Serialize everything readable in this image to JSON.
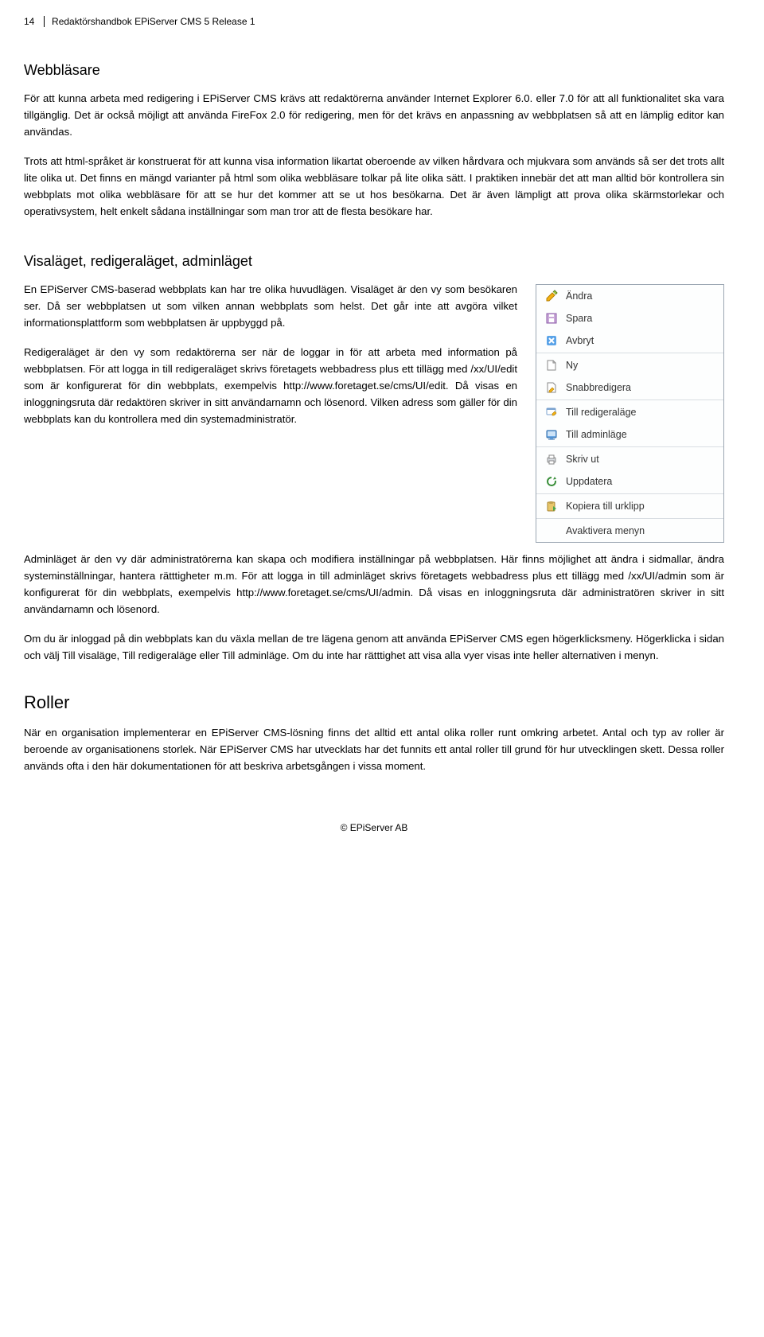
{
  "header": {
    "page_number": "14",
    "doc_title": "Redaktörshandbok EPiServer CMS 5 Release 1"
  },
  "sections": {
    "webblasare": {
      "title": "Webbläsare",
      "p1": "För att kunna arbeta med redigering i EPiServer CMS krävs att redaktörerna använder Internet Explorer 6.0. eller 7.0 för att all funktionalitet ska vara tillgänglig. Det är också möjligt att använda FireFox 2.0 för redigering, men för det krävs en anpassning av webbplatsen så att en lämplig editor kan användas.",
      "p2": "Trots att html-språket är konstruerat för att kunna visa information likartat oberoende av vilken hårdvara och mjukvara som används så ser det trots allt lite olika ut. Det finns en mängd varianter på html som olika webbläsare tolkar på lite olika sätt. I praktiken innebär det att man alltid bör kontrollera sin webbplats mot olika webbläsare för att se hur det kommer att se ut hos besökarna. Det är även lämpligt att prova olika skärmstorlekar och operativsystem, helt enkelt sådana inställningar som man tror att de flesta besökare har."
    },
    "visalaget": {
      "title": "Visaläget, redigeraläget, adminläget",
      "p1": "En EPiServer CMS-baserad webbplats kan har tre olika huvudlägen. Visaläget är den vy som besökaren ser. Då ser webbplatsen ut som vilken annan webbplats som helst. Det går inte att avgöra vilket informationsplattform som webbplatsen är uppbyggd på.",
      "p2": "Redigeraläget är den vy som redaktörerna ser när de loggar in för att arbeta med information på webbplatsen. För att logga in till redigeraläget skrivs företagets webbadress plus ett tillägg med /xx/UI/edit som är konfigurerat för din webbplats, exempelvis http://www.foretaget.se/cms/UI/edit. Då visas en inloggningsruta där redaktören skriver in sitt användarnamn och lösenord. Vilken adress som gäller för din webbplats kan du kontrollera med din systemadministratör.",
      "p3": "Adminläget är den vy där administratörerna kan skapa och modifiera inställningar på webbplatsen. Här finns möjlighet att ändra i sidmallar, ändra systeminställningar, hantera rätttigheter m.m. För att logga in till adminläget skrivs företagets webbadress plus ett tillägg med /xx/UI/admin som är konfigurerat för din webbplats, exempelvis http://www.foretaget.se/cms/UI/admin. Då visas en inloggningsruta där administratören skriver in sitt användarnamn och lösenord.",
      "p4": "Om du är inloggad på din webbplats kan du växla mellan de tre lägena genom att använda EPiServer CMS egen högerklicksmeny. Högerklicka i sidan och välj Till visaläge, Till redigeraläge eller Till adminläge. Om du inte har rätttighet att visa alla vyer visas inte heller alternativen i menyn."
    },
    "context_menu": {
      "items": [
        {
          "label": "Ändra",
          "icon": "pencil-icon"
        },
        {
          "label": "Spara",
          "icon": "save-icon"
        },
        {
          "label": "Avbryt",
          "icon": "cancel-icon"
        },
        {
          "label": "Ny",
          "icon": "new-page-icon"
        },
        {
          "label": "Snabbredigera",
          "icon": "quick-edit-icon"
        },
        {
          "label": "Till redigeraläge",
          "icon": "to-edit-mode-icon"
        },
        {
          "label": "Till adminläge",
          "icon": "to-admin-mode-icon"
        },
        {
          "label": "Skriv ut",
          "icon": "print-icon"
        },
        {
          "label": "Uppdatera",
          "icon": "refresh-icon"
        },
        {
          "label": "Kopiera till urklipp",
          "icon": "copy-clipboard-icon"
        },
        {
          "label": "Avaktivera menyn",
          "icon": ""
        }
      ]
    },
    "roller": {
      "title": "Roller",
      "p1": "När en organisation implementerar en EPiServer CMS-lösning finns det alltid ett antal olika roller runt omkring arbetet. Antal och typ av roller är beroende av organisationens storlek. När EPiServer CMS har utvecklats har det funnits ett antal roller till grund för hur utvecklingen skett. Dessa roller används ofta i den här dokumentationen för att beskriva arbetsgången i vissa moment."
    }
  },
  "footer": {
    "copyright": "© EPiServer AB"
  }
}
